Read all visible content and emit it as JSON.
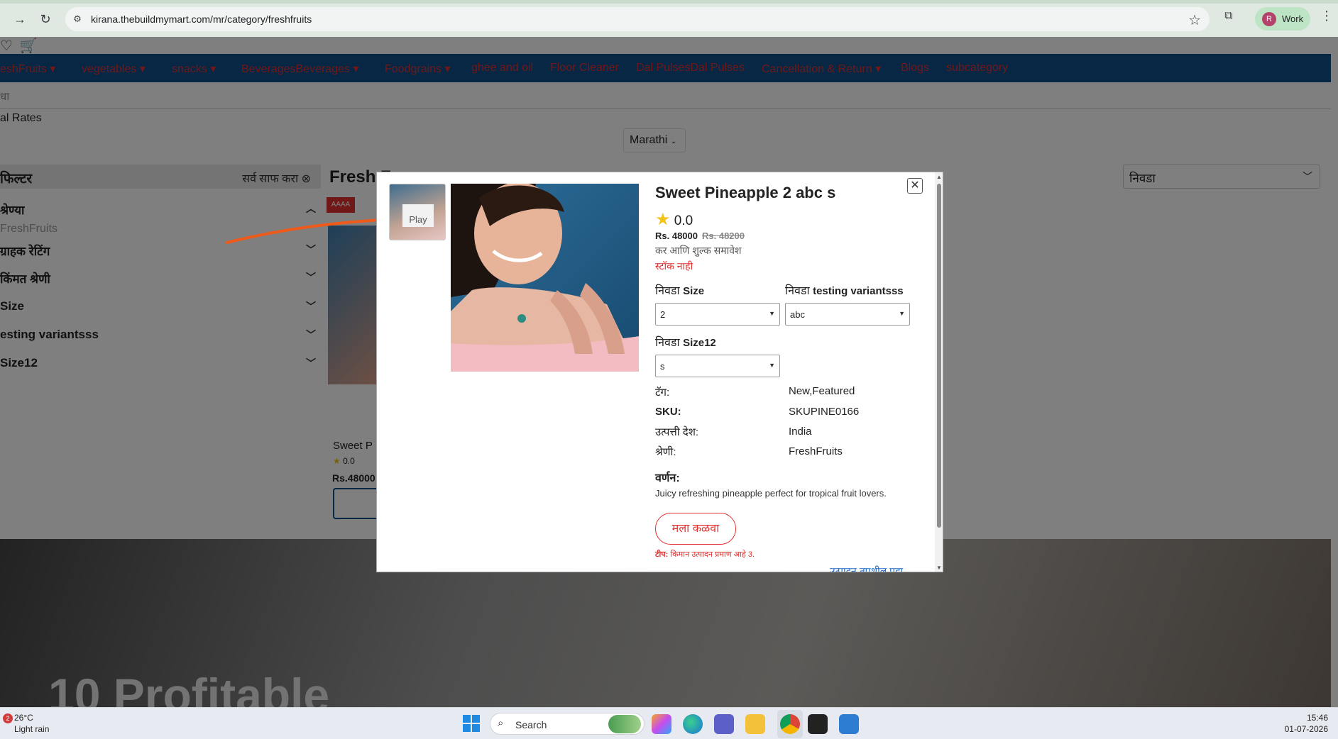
{
  "browser": {
    "url": "kirana.thebuildmymart.com/mr/category/freshfruits",
    "profile_initial": "R",
    "profile_label": "Work"
  },
  "site": {
    "categories": [
      "eshFruits ▾",
      "vegetables ▾",
      "snacks ▾",
      "BeveragesBeverages ▾",
      "Foodgrains ▾",
      "ghee and oil",
      "Floor Cleaner",
      "Dal PulsesDal Pulses",
      "Cancellation & Return ▾",
      "Blogs",
      "subcategory"
    ],
    "search_placeholder": "धा",
    "rates_text": "al Rates",
    "language": "Marathi",
    "filter_title": "फिल्टर",
    "clear_all": "सर्व साफ करा ⊗",
    "filter_rows": [
      "श्रेण्या",
      "ग्राहक रेटिंग",
      "किंमत श्रेणी",
      "Size",
      "esting variantsss",
      "Size12"
    ],
    "filter_sub": "FreshFruits",
    "product_heading": "Fresh F",
    "sort_label": "निवडा",
    "card": {
      "badge": "AAAA",
      "name": "Sweet P",
      "rating": "0.0",
      "price": "Rs.48000"
    },
    "banner_text": "10 Profitable"
  },
  "modal": {
    "thumb_alt": "Play",
    "title": "Sweet Pineapple 2 abc s",
    "rating": "0.0",
    "price": "Rs. 48000",
    "old_price": "Rs. 48200",
    "tax_note": "कर आणि शुल्क समावेश",
    "stock": "स्टॉक नाही",
    "variants": [
      {
        "label_prefix": "निवडा",
        "label_name": "Size",
        "value": "2"
      },
      {
        "label_prefix": "निवडा",
        "label_name": "testing variantsss",
        "value": "abc"
      },
      {
        "label_prefix": "निवडा",
        "label_name": "Size12",
        "value": "s"
      }
    ],
    "specs": [
      {
        "key": "टॅग:",
        "value": "New,Featured"
      },
      {
        "key": "SKU:",
        "value": "SKUPINE0166"
      },
      {
        "key": "उत्पत्ती देश:",
        "value": "India"
      },
      {
        "key": "श्रेणी:",
        "value": "FreshFruits"
      }
    ],
    "description_heading": "वर्णन:",
    "description": "Juicy refreshing pineapple perfect for tropical fruit lovers.",
    "notify_label": "मला कळवा",
    "tip_prefix": "टीप:",
    "tip_text": "किमान उत्पादन प्रमाण आहे 3.",
    "detail_link": "उत्पादन तपशील पहा"
  },
  "taskbar": {
    "notif_count": "2",
    "temperature": "26°C",
    "weather": "Light rain",
    "search_label": "Search",
    "time": "15:46",
    "date": "01-07-2026"
  },
  "colors": {
    "nav_blue": "#0f4f8a",
    "accent_red": "#e03030",
    "annotation_orange": "#f05a1a"
  }
}
